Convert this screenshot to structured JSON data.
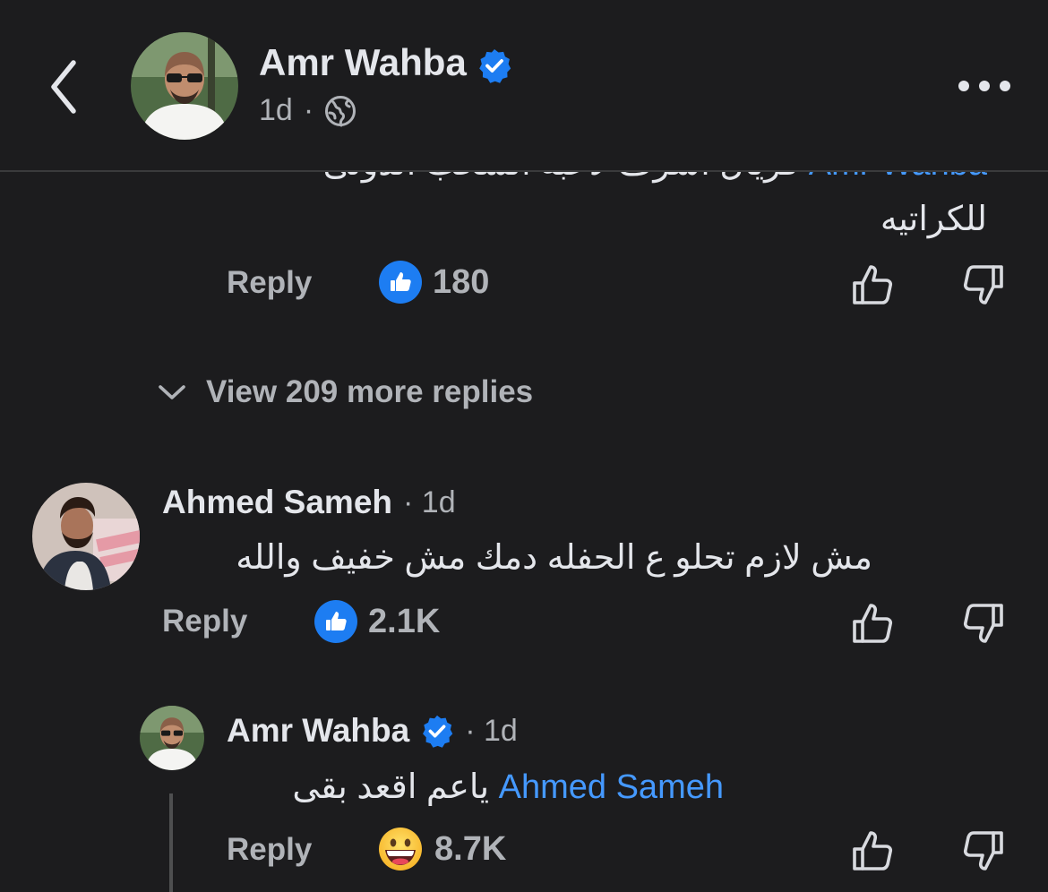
{
  "header": {
    "name": "Amr Wahba",
    "time": "1d",
    "separator": "·"
  },
  "comments": {
    "top": {
      "cut_mention": "Amr Wahba",
      "cut_text": "فريال اشرف لاعبة السحب الدولى",
      "line2": "للكراتيه",
      "reply_label": "Reply",
      "likes": "180"
    },
    "view_more": "View 209 more replies",
    "ahmed": {
      "name": "Ahmed Sameh",
      "meta": "· 1d",
      "text": "مش لازم تحلو ع الحفله دمك مش خفيف والله",
      "reply_label": "Reply",
      "likes": "2.1K"
    },
    "amr_reply": {
      "name": "Amr Wahba",
      "meta": "· 1d",
      "mention": "Ahmed Sameh",
      "text": "ياعم اقعد بقى",
      "reply_label": "Reply",
      "reactions": "8.7K"
    }
  },
  "colors": {
    "background": "#1c1c1e",
    "accent_blue": "#4599ff",
    "like_badge": "#1d7df2",
    "muted_text": "#b0b3b8",
    "primary_text": "#e4e6eb"
  },
  "icons": [
    "back-chevron-icon",
    "verified-badge-icon",
    "globe-icon",
    "more-dots-icon",
    "like-badge-icon",
    "thumbs-up-icon",
    "thumbs-down-icon",
    "chevron-down-icon",
    "grinning-emoji-icon"
  ]
}
